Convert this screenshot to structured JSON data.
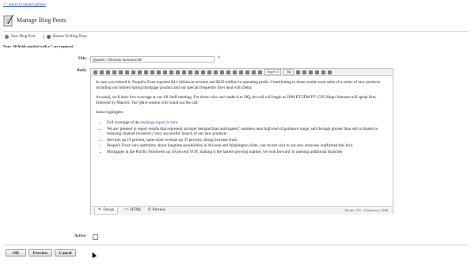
{
  "top_link": "<< return to inland options",
  "page_title": "Manage Blog Posts",
  "toolbar": {
    "new_post": "New Blog Post",
    "return_posts": "Return To Blog Posts"
  },
  "required_note": "Note: All fields marked with a * are required.",
  "form": {
    "title_label": "Title:",
    "title_value": "Quarter 3 Results Announced!",
    "required_mark": "*",
    "body_label": "Body:",
    "active_label": "Active:"
  },
  "editor": {
    "font_name": "Segoe UI",
    "font_size": "10pt",
    "p1": "In case you missed it, People's Trust reported $4.1 billion in revenue and $220 million in operating profit. Contributing to those results were sales of a series of new products including our limited Spring mortgage product and our special frequently flyer deal with Delta.",
    "p2": "As usual, we'll have live coverage at our All Staff meeting. For those who can't make it to HQ, the call will begin at 2PM ET/5PM PT. CFO Hugo Johnson will speak first, followed by Maestri. The Q&A session will round out the call.",
    "p3": "Some highlights:",
    "b1_prefix": "Full coverage of the ",
    "b1_link": "earnings report is here",
    "b1_suffix": ".",
    "b2": "We are 'pleased to report results that represent stronger demand than anticipated,' numbers near high end of guidance range, sell through greater than sell in thanks to reducing channel inventory; 'very successful' launch of our new products",
    "b3": "Services up 19 percent, same store revenue up 37 percent, strong increase from",
    "b4": "People's Trust 'very optimistic about longtime possibilities in Arizona and Washington State,' our recent visit to our new branches reaffirmed this fact;",
    "b5": "Mortgages in the Pacific Northwest up 50 percent YOY, making it the fastest-growing market; we look forward' to opening additional branches",
    "mode_design": "Design",
    "mode_html": "HTML",
    "mode_preview": "Preview",
    "words": "Words: 191",
    "characters": "Characters: 1186"
  },
  "buttons": {
    "ok": "OK",
    "preview": "Preview",
    "cancel": "Cancel"
  }
}
